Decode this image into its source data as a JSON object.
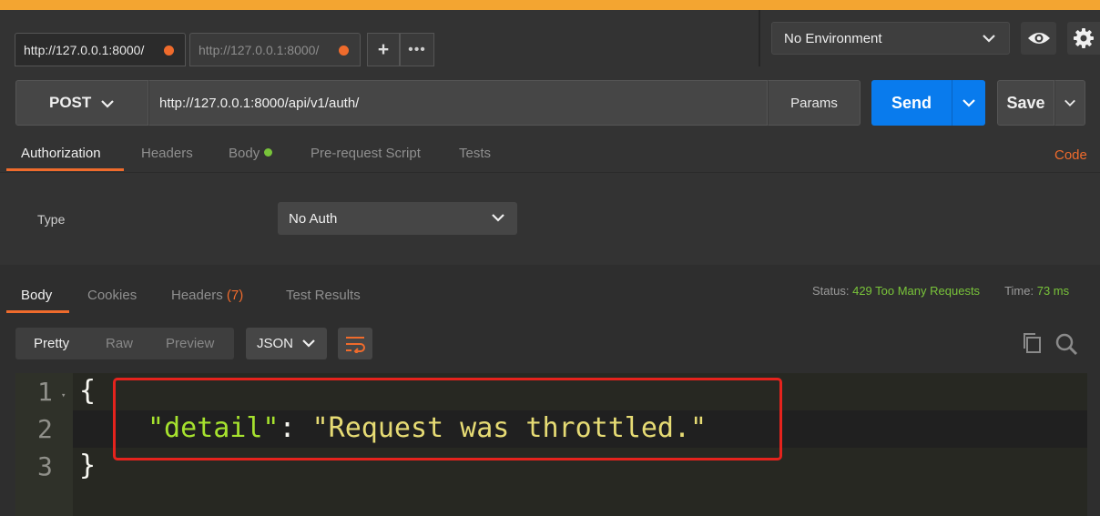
{
  "tabs": [
    {
      "label": "http://127.0.0.1:8000/"
    },
    {
      "label": "http://127.0.0.1:8000/"
    }
  ],
  "tab_actions": {
    "add": "+",
    "more": "•••"
  },
  "environment": {
    "selected": "No Environment"
  },
  "request": {
    "method": "POST",
    "url": "http://127.0.0.1:8000/api/v1/auth/",
    "params_label": "Params",
    "send_label": "Send",
    "save_label": "Save"
  },
  "request_tabs": [
    {
      "label": "Authorization"
    },
    {
      "label": "Headers"
    },
    {
      "label": "Body"
    },
    {
      "label": "Pre-request Script"
    },
    {
      "label": "Tests"
    }
  ],
  "code_link": "Code",
  "auth": {
    "type_label": "Type",
    "selected": "No Auth"
  },
  "response_tabs": [
    {
      "label": "Body"
    },
    {
      "label": "Cookies"
    },
    {
      "label": "Headers",
      "count": "(7)"
    },
    {
      "label": "Test Results"
    }
  ],
  "status": {
    "label": "Status:",
    "value": "429 Too Many Requests",
    "time_label": "Time:",
    "time_value": "73 ms"
  },
  "view_modes": [
    "Pretty",
    "Raw",
    "Preview"
  ],
  "format": {
    "selected": "JSON"
  },
  "code": {
    "line_numbers": [
      "1",
      "2",
      "3"
    ],
    "open_brace": "{",
    "key": "\"detail\"",
    "colon": ": ",
    "value": "\"Request was throttled.\"",
    "close_brace": "}"
  },
  "colors": {
    "accent_orange": "#ef6b2c",
    "send_blue": "#097bed",
    "status_green": "#79c43a",
    "highlight_red": "#e5231d",
    "top_bar": "#f3a531"
  }
}
